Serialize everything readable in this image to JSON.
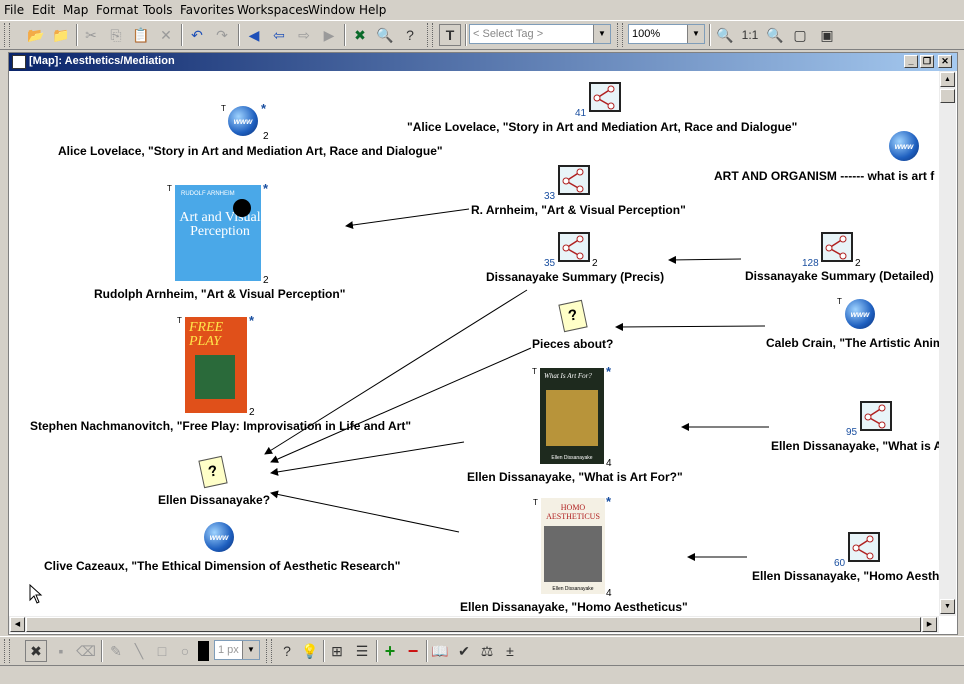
{
  "menu": [
    "File",
    "Edit",
    "Map",
    "Format",
    "Tools",
    "Favorites",
    "Workspaces",
    "Window",
    "Help"
  ],
  "toolbar": {
    "tag_placeholder": "< Select Tag >",
    "zoom": "100%",
    "zoom_actual": "1:1",
    "text_tool": "T"
  },
  "window": {
    "title": "[Map]: Aesthetics/Mediation"
  },
  "nodes": {
    "alice_ref": {
      "label": "Alice Lovelace, \"Story in Art and Mediation  Art, Race and Dialogue\"",
      "badge": "2"
    },
    "alice_map": {
      "label": "\"Alice Lovelace,  \"Story in Art and Mediation  Art, Race and Dialogue\"",
      "count": "41"
    },
    "art_organism": {
      "label": "ART AND ORGANISM ------      what is art f"
    },
    "arnheim_book": {
      "label": "Rudolph Arnheim, \"Art & Visual Perception\"",
      "badge": "2",
      "cover_author": "RUDOLF ARNHEIM",
      "cover_title": "Art and Visual Perception"
    },
    "arnheim_map": {
      "label": "R. Arnheim, \"Art & Visual Perception\"",
      "count": "33"
    },
    "diss_precis": {
      "label": "Dissanayake Summary (Precis)",
      "count": "35",
      "badge": "2"
    },
    "diss_detailed": {
      "label": "Dissanayake Summary (Detailed)",
      "count": "128",
      "badge": "2"
    },
    "pieces": {
      "label": "Pieces about?"
    },
    "caleb": {
      "label": "Caleb Crain, \"The Artistic Anim"
    },
    "freeplay": {
      "label": "Stephen Nachmanovitch, \"Free Play: Improvisation in Life and Art\"",
      "badge": "2",
      "cover_title": "FREE PLAY"
    },
    "whatisart_book": {
      "label": "Ellen Dissanayake, \"What is Art For?\"",
      "badge": "4",
      "cover_title": "What Is Art For?",
      "cover_author": "Ellen Dissanayake"
    },
    "whatisart_map": {
      "label": "Ellen Dissanayake, \"What is A",
      "count": "95"
    },
    "ellen_q": {
      "label": "Ellen Dissanayake?"
    },
    "clive": {
      "label": "Clive Cazeaux, \"The Ethical Dimension of Aesthetic Research\""
    },
    "homo_book": {
      "label": "Ellen Dissanayake, \"Homo Aestheticus\"",
      "badge": "4",
      "cover_title": "HOMO AESTHETICUS",
      "cover_author": "Ellen Dissanayake"
    },
    "homo_map": {
      "label": "Ellen Dissanayake, \"Homo Aesthe",
      "count": "60"
    }
  },
  "bottom_toolbar": {
    "line_width": "1 px"
  },
  "colors": {
    "title_start": "#0a246a",
    "title_end": "#a6caf0",
    "count_blue": "#1a4fa0"
  }
}
